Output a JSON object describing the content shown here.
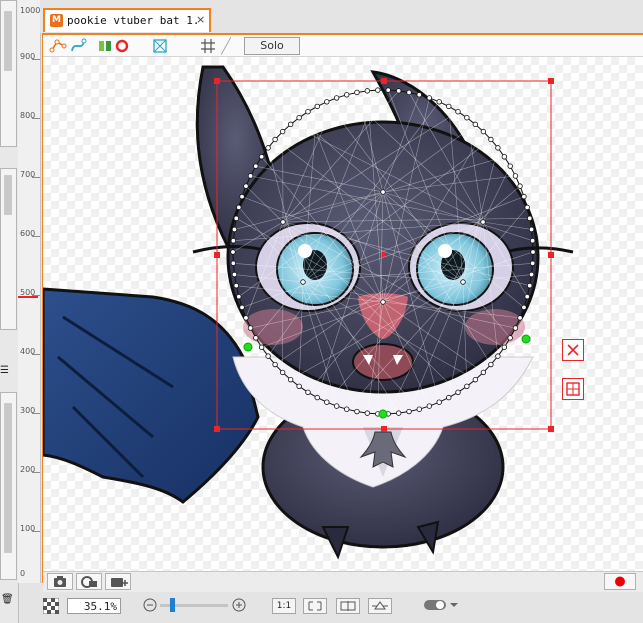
{
  "tab": {
    "title": "pookie vtuber bat 1.",
    "close": "×",
    "logo": "M"
  },
  "toolbar": {
    "solo_label": "Solo"
  },
  "vertical_ruler": {
    "labels": [
      "1000",
      "900",
      "800",
      "700",
      "600",
      "500",
      "400",
      "300",
      "200",
      "100",
      "0"
    ]
  },
  "status_bar": {
    "zoom_value": "35.1",
    "zoom_unit": "%",
    "actual_size_label": "1:1"
  },
  "colors": {
    "accent": "#f08020",
    "selection": "#e8262a",
    "handle_green": "#22dd22",
    "record": "#ee0000"
  },
  "icons": [
    "deformer-path-icon",
    "bezier-icon",
    "glue-icon",
    "rotation-icon",
    "mesh-icon",
    "grid-icon",
    "camera-icon",
    "camera-settings-icon",
    "camera-add-icon",
    "record-icon",
    "checker-icon",
    "zoom-out-icon",
    "zoom-in-icon",
    "fit-icon",
    "flip-icon",
    "reset-icon",
    "toggle-icon",
    "close-deformer-icon",
    "warp-deformer-icon"
  ]
}
